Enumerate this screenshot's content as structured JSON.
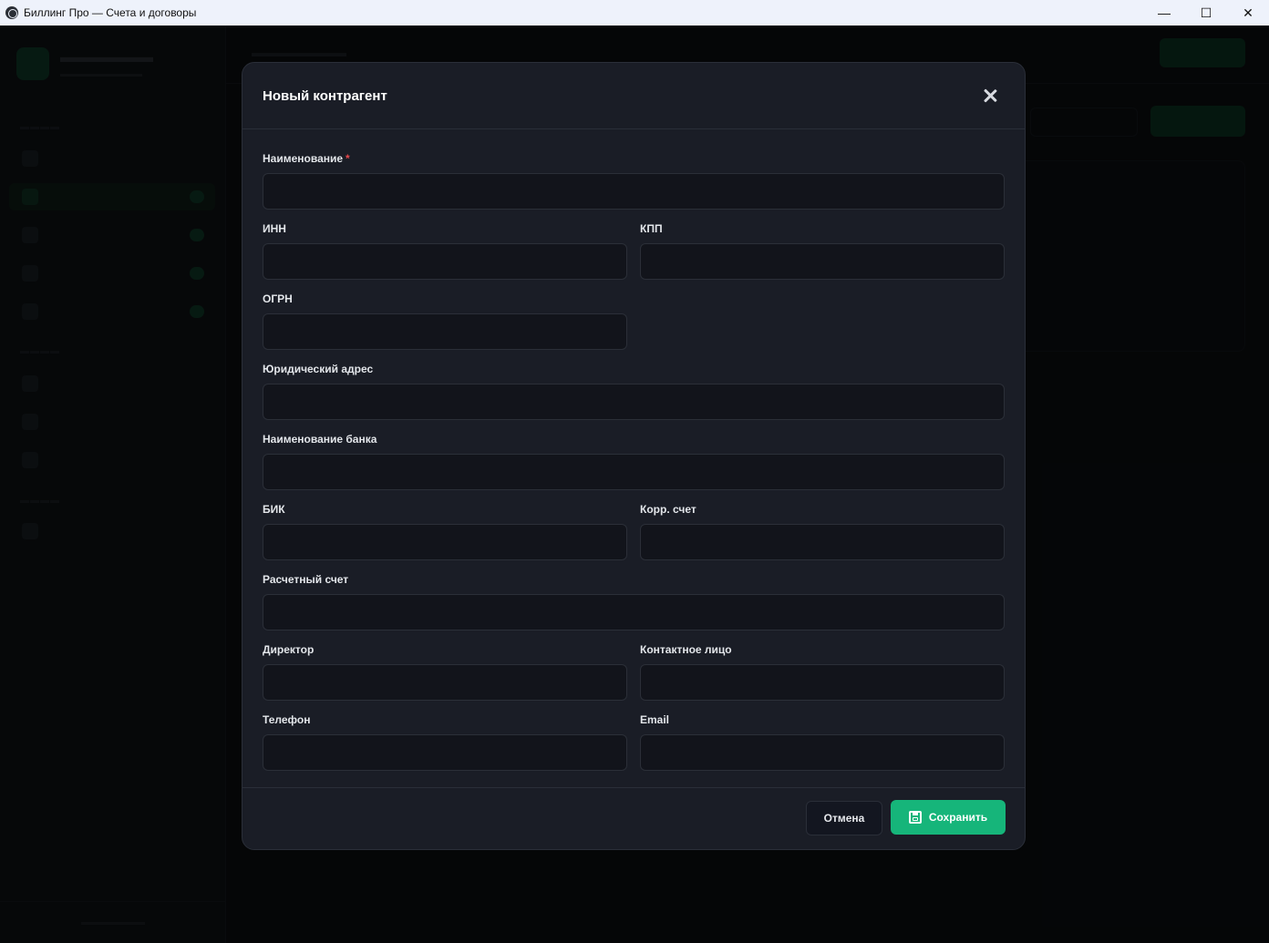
{
  "window": {
    "title": "Биллинг Про — Счета и договоры",
    "minimize": "—",
    "maximize": "☐",
    "close": "✕"
  },
  "modal": {
    "title": "Новый контрагент",
    "required_mark": "*",
    "fields": {
      "name": {
        "label": "Наименование",
        "value": ""
      },
      "inn": {
        "label": "ИНН",
        "value": ""
      },
      "kpp": {
        "label": "КПП",
        "value": ""
      },
      "ogrn": {
        "label": "ОГРН",
        "value": ""
      },
      "legal_address": {
        "label": "Юридический адрес",
        "value": ""
      },
      "bank_name": {
        "label": "Наименование банка",
        "value": ""
      },
      "bik": {
        "label": "БИК",
        "value": ""
      },
      "corr_account": {
        "label": "Корр. счет",
        "value": ""
      },
      "settlement_account": {
        "label": "Расчетный счет",
        "value": ""
      },
      "director": {
        "label": "Директор",
        "value": ""
      },
      "contact_person": {
        "label": "Контактное лицо",
        "value": ""
      },
      "phone": {
        "label": "Телефон",
        "value": ""
      },
      "email": {
        "label": "Email",
        "value": ""
      }
    },
    "buttons": {
      "cancel": "Отмена",
      "save": "Сохранить"
    }
  },
  "icons": {
    "app": "globe-icon",
    "close": "close-icon",
    "save": "floppy-disk-icon"
  },
  "colors": {
    "accent": "#16b57a",
    "required": "#e5484d",
    "modal_bg": "#1a1d26",
    "input_bg": "#12141b"
  }
}
